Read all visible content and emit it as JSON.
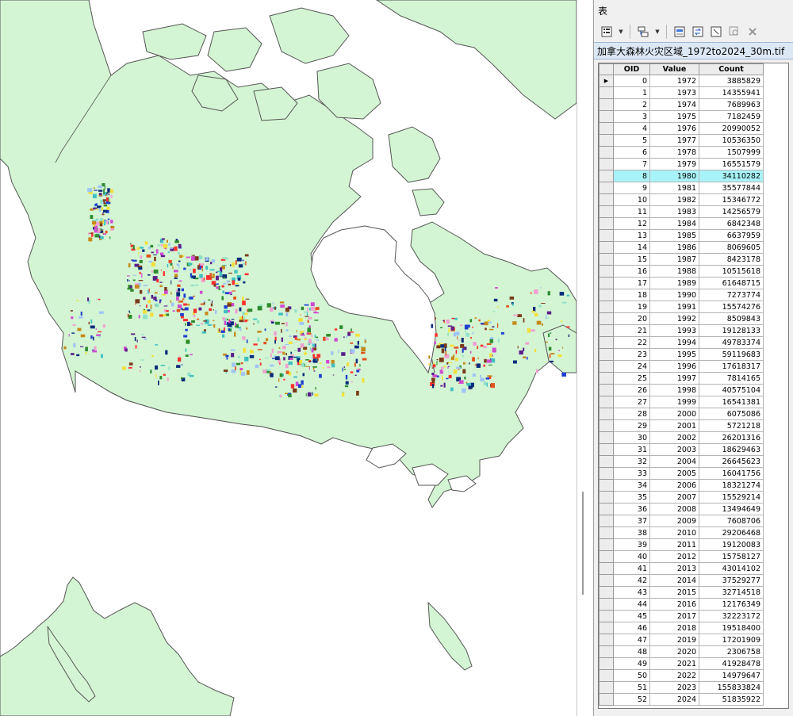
{
  "table_window": {
    "title": "表",
    "layer_tab": "加拿大森林火灾区域_1972to2024_30m.tif",
    "toolbar_icons": [
      "table-options-icon",
      "related-tables-icon",
      "select-by-attributes-icon",
      "switch-selection-icon",
      "clear-selection-icon",
      "zoom-to-selected-icon",
      "delete-selected-icon"
    ]
  },
  "grid": {
    "columns": [
      "OID",
      "Value",
      "Count"
    ],
    "current_row_marker": "▶",
    "highlighted_oid": 8,
    "highlight_color": "#a8f3f7",
    "rows": [
      {
        "oid": "0",
        "value": "1972",
        "count": "3885829"
      },
      {
        "oid": "1",
        "value": "1973",
        "count": "14355941"
      },
      {
        "oid": "2",
        "value": "1974",
        "count": "7689963"
      },
      {
        "oid": "3",
        "value": "1975",
        "count": "7182459"
      },
      {
        "oid": "4",
        "value": "1976",
        "count": "20990052"
      },
      {
        "oid": "5",
        "value": "1977",
        "count": "10536350"
      },
      {
        "oid": "6",
        "value": "1978",
        "count": "1507999"
      },
      {
        "oid": "7",
        "value": "1979",
        "count": "16551579"
      },
      {
        "oid": "8",
        "value": "1980",
        "count": "34110282"
      },
      {
        "oid": "9",
        "value": "1981",
        "count": "35577844"
      },
      {
        "oid": "10",
        "value": "1982",
        "count": "15346772"
      },
      {
        "oid": "11",
        "value": "1983",
        "count": "14256579"
      },
      {
        "oid": "12",
        "value": "1984",
        "count": "6842348"
      },
      {
        "oid": "13",
        "value": "1985",
        "count": "6637959"
      },
      {
        "oid": "14",
        "value": "1986",
        "count": "8069605"
      },
      {
        "oid": "15",
        "value": "1987",
        "count": "8423178"
      },
      {
        "oid": "16",
        "value": "1988",
        "count": "10515618"
      },
      {
        "oid": "17",
        "value": "1989",
        "count": "61648715"
      },
      {
        "oid": "18",
        "value": "1990",
        "count": "7273774"
      },
      {
        "oid": "19",
        "value": "1991",
        "count": "15574276"
      },
      {
        "oid": "20",
        "value": "1992",
        "count": "8509843"
      },
      {
        "oid": "21",
        "value": "1993",
        "count": "19128133"
      },
      {
        "oid": "22",
        "value": "1994",
        "count": "49783374"
      },
      {
        "oid": "23",
        "value": "1995",
        "count": "59119683"
      },
      {
        "oid": "24",
        "value": "1996",
        "count": "17618317"
      },
      {
        "oid": "25",
        "value": "1997",
        "count": "7814165"
      },
      {
        "oid": "26",
        "value": "1998",
        "count": "40575104"
      },
      {
        "oid": "27",
        "value": "1999",
        "count": "16541381"
      },
      {
        "oid": "28",
        "value": "2000",
        "count": "6075086"
      },
      {
        "oid": "29",
        "value": "2001",
        "count": "5721218"
      },
      {
        "oid": "30",
        "value": "2002",
        "count": "26201316"
      },
      {
        "oid": "31",
        "value": "2003",
        "count": "18629463"
      },
      {
        "oid": "32",
        "value": "2004",
        "count": "26645623"
      },
      {
        "oid": "33",
        "value": "2005",
        "count": "16041756"
      },
      {
        "oid": "34",
        "value": "2006",
        "count": "18321274"
      },
      {
        "oid": "35",
        "value": "2007",
        "count": "15529214"
      },
      {
        "oid": "36",
        "value": "2008",
        "count": "13494649"
      },
      {
        "oid": "37",
        "value": "2009",
        "count": "7608706"
      },
      {
        "oid": "38",
        "value": "2010",
        "count": "29206468"
      },
      {
        "oid": "39",
        "value": "2011",
        "count": "19120083"
      },
      {
        "oid": "40",
        "value": "2012",
        "count": "15758127"
      },
      {
        "oid": "41",
        "value": "2013",
        "count": "43014102"
      },
      {
        "oid": "42",
        "value": "2014",
        "count": "37529277"
      },
      {
        "oid": "43",
        "value": "2015",
        "count": "32714518"
      },
      {
        "oid": "44",
        "value": "2016",
        "count": "12176349"
      },
      {
        "oid": "45",
        "value": "2017",
        "count": "32223172"
      },
      {
        "oid": "46",
        "value": "2018",
        "count": "19518400"
      },
      {
        "oid": "47",
        "value": "2019",
        "count": "17201909"
      },
      {
        "oid": "48",
        "value": "2020",
        "count": "2306758"
      },
      {
        "oid": "49",
        "value": "2021",
        "count": "41928478"
      },
      {
        "oid": "50",
        "value": "2022",
        "count": "14979647"
      },
      {
        "oid": "51",
        "value": "2023",
        "count": "155833824"
      },
      {
        "oid": "52",
        "value": "2024",
        "count": "51835922"
      }
    ]
  },
  "map": {
    "land_color": "#d3f5d3",
    "water_color": "#ffffff",
    "outline_color": "#555555",
    "fire_palette": [
      "#0a2a7a",
      "#1f3fd0",
      "#e0531f",
      "#c58a1a",
      "#f2e03a",
      "#2e8b2e",
      "#8fe0c8",
      "#d04ad0",
      "#9fc4f7",
      "#7a3a1a",
      "#ff3030",
      "#40c0c0",
      "#5a1f8a",
      "#f0a0d0"
    ]
  }
}
